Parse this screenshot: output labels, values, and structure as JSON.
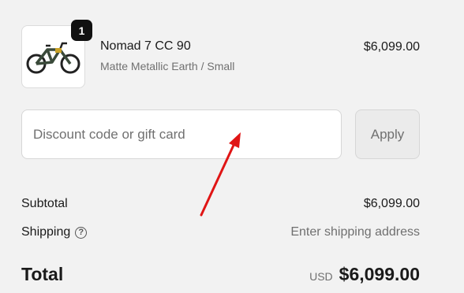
{
  "product": {
    "quantity": "1",
    "name": "Nomad 7 CC 90",
    "variant": "Matte Metallic Earth / Small",
    "price": "$6,099.00",
    "image_icon": "mountain-bike-image"
  },
  "discount": {
    "placeholder": "Discount code or gift card",
    "value": "",
    "apply_label": "Apply"
  },
  "summary": {
    "subtotal_label": "Subtotal",
    "subtotal_value": "$6,099.00",
    "shipping_label": "Shipping",
    "shipping_help_icon": "question-circle-icon",
    "shipping_value": "Enter shipping address",
    "total_label": "Total",
    "currency": "USD",
    "total_value": "$6,099.00"
  },
  "colors": {
    "background": "#f2f2f2",
    "badge": "#111111",
    "annotation_arrow": "#e01515"
  }
}
